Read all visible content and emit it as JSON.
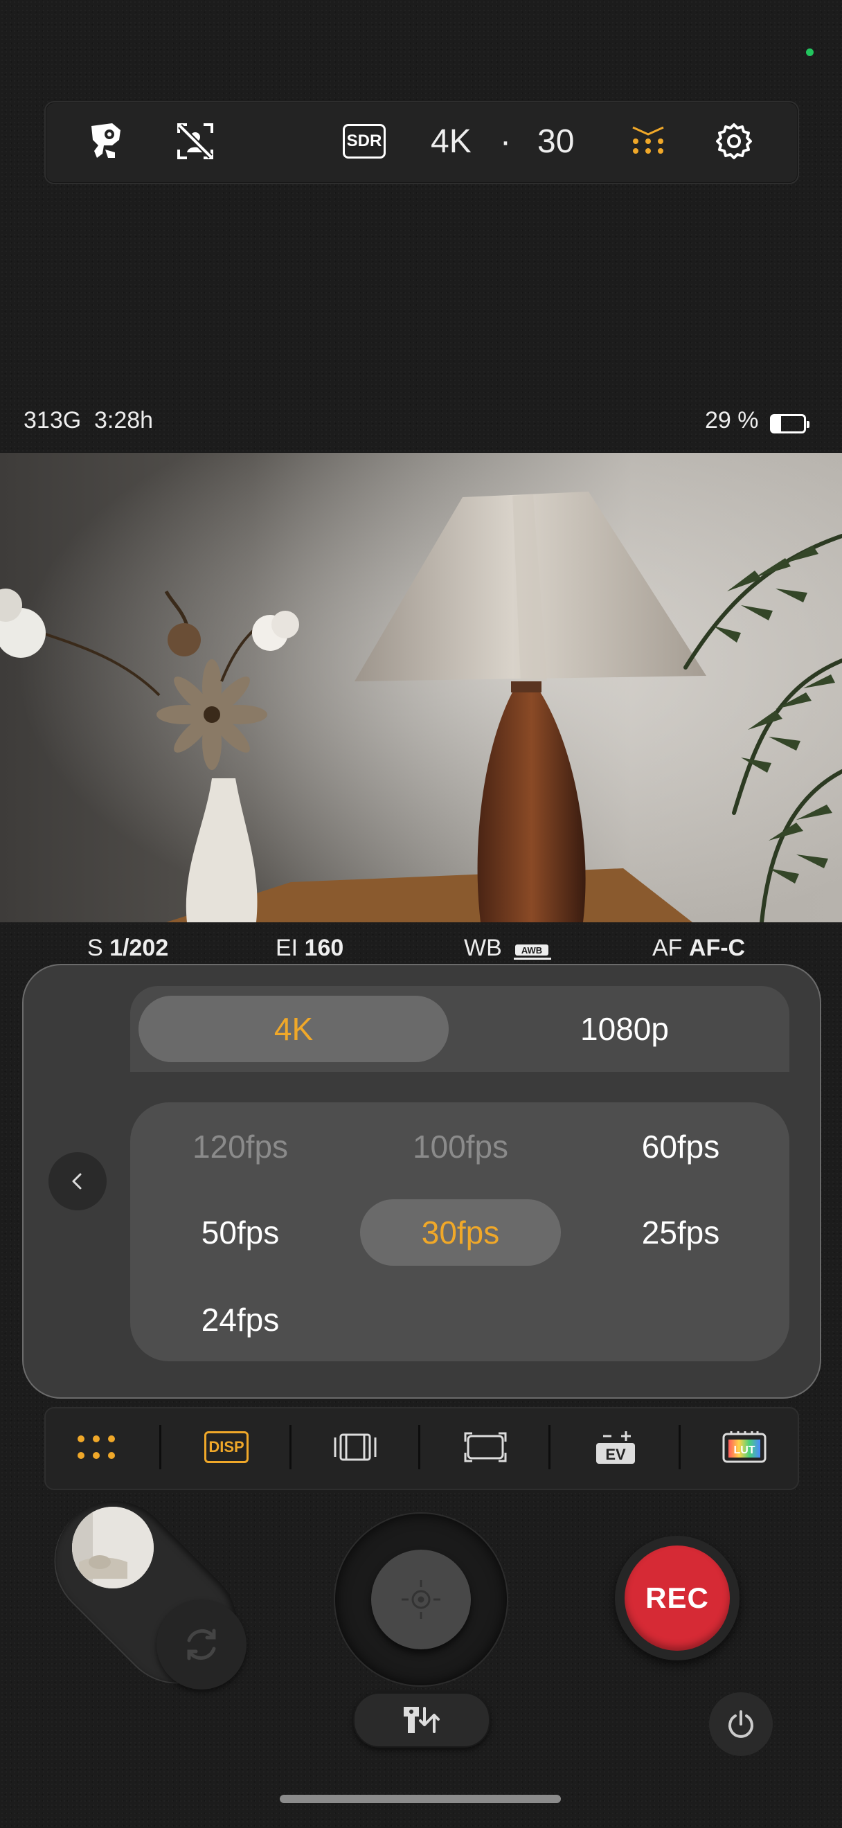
{
  "top_toolbar": {
    "icons": [
      "camera-mount-icon",
      "face-detect-off-icon",
      "sdr-icon",
      "grid-dots-icon",
      "gear-icon"
    ],
    "sdr_label": "SDR",
    "resolution": "4K",
    "separator": "·",
    "frame_rate": "30",
    "accent": "#f0a829"
  },
  "status": {
    "storage": "313G",
    "record_time": "3:28h",
    "battery": "29 %"
  },
  "params": {
    "shutter_label": "S",
    "shutter_value": "1/202",
    "ei_label": "EI",
    "ei_value": "160",
    "wb_label": "WB",
    "wb_value": "AWB",
    "af_label": "AF",
    "af_value": "AF-C"
  },
  "format_panel": {
    "resolutions": [
      {
        "label": "4K",
        "selected": true
      },
      {
        "label": "1080p",
        "selected": false
      }
    ],
    "fps": [
      {
        "label": "120fps",
        "state": "disabled"
      },
      {
        "label": "100fps",
        "state": "disabled"
      },
      {
        "label": "60fps",
        "state": "normal"
      },
      {
        "label": "50fps",
        "state": "normal"
      },
      {
        "label": "30fps",
        "state": "selected"
      },
      {
        "label": "25fps",
        "state": "normal"
      },
      {
        "label": "24fps",
        "state": "normal"
      }
    ]
  },
  "tool_strip": {
    "disp_label": "DISP",
    "ev_label": "EV",
    "lut_label": "LUT"
  },
  "controls": {
    "rec_label": "REC",
    "rec_color": "#d62a35"
  }
}
